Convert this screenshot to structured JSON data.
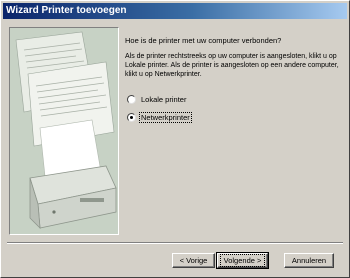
{
  "window": {
    "title": "Wizard Printer toevoegen"
  },
  "content": {
    "question": "Hoe is de printer met uw computer verbonden?",
    "description": "Als de printer rechtstreeks op uw computer is aangesloten, klikt u op Lokale printer. Als de printer is aangesloten op een andere computer, klikt u op Netwerkprinter.",
    "options": [
      {
        "label": "Lokale printer",
        "selected": false
      },
      {
        "label": "Netwerkprinter",
        "selected": true
      }
    ]
  },
  "buttons": {
    "back": "< Vorige",
    "next": "Volgende >",
    "cancel": "Annuleren"
  },
  "colors": {
    "dialog_face": "#d4d0c8",
    "titlebar_start": "#0a246a",
    "titlebar_end": "#a6caf0"
  }
}
